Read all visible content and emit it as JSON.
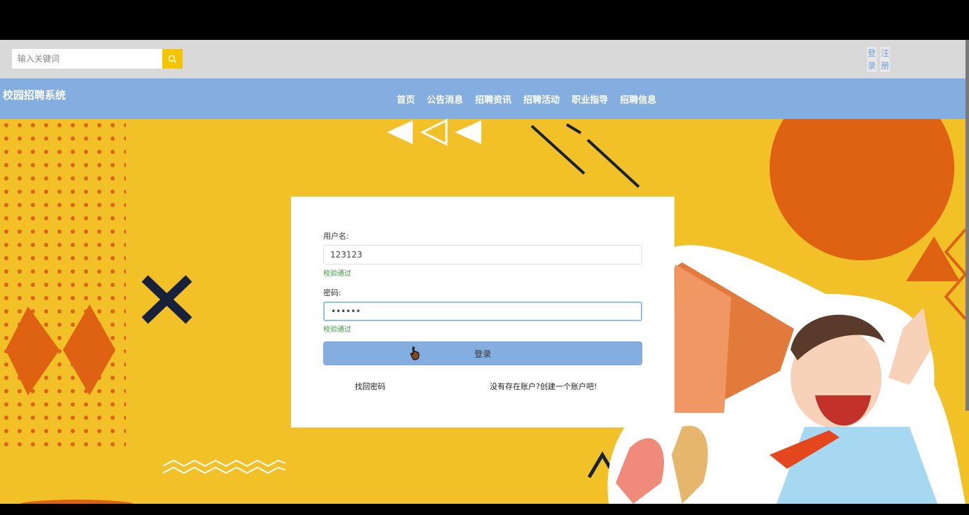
{
  "search": {
    "placeholder": "输入关键词",
    "icon": "search-icon"
  },
  "auth": {
    "login_label": "登录",
    "login_chars": [
      "登",
      "录"
    ],
    "register_label": "注册",
    "register_chars": [
      "注",
      "册"
    ]
  },
  "header": {
    "brand": "校园招聘系统",
    "nav": [
      "首页",
      "公告消息",
      "招聘资讯",
      "招聘活动",
      "职业指导",
      "招聘信息"
    ]
  },
  "login_form": {
    "username_label": "用户名:",
    "username_value": "123123",
    "username_status": "校验通过",
    "password_label": "密码:",
    "password_value": "••••••",
    "password_status": "校验通过",
    "submit_label": "登录",
    "forgot_link": "找回密码",
    "register_link": "没有存在账户?创建一个账户吧!"
  },
  "colors": {
    "nav_bg": "#84aedf",
    "hero_bg": "#f2c128",
    "accent_orange": "#df6212",
    "search_button": "#f5c400",
    "valid_green": "#3c9a3c"
  }
}
